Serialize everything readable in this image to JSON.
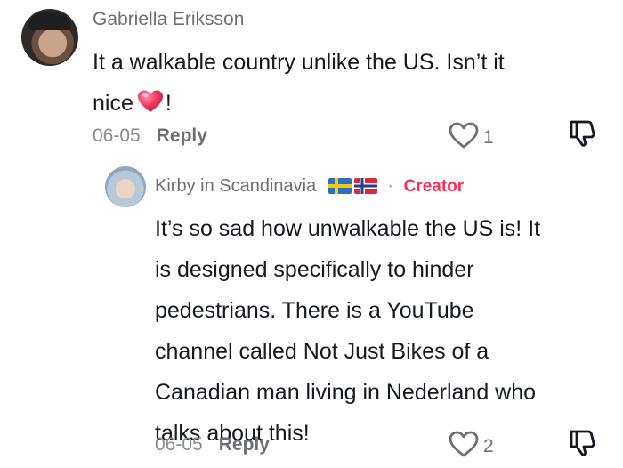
{
  "comments": [
    {
      "author": "Gabriella Eriksson",
      "text_lines": [
        "It a walkable country unlike the US. Isn’t it",
        "nice",
        "!"
      ],
      "date": "06-05",
      "reply_label": "Reply",
      "likes": "1"
    },
    {
      "author": "Kirby in Scandinavia",
      "creator_label": "Creator",
      "separator": "·",
      "text_lines": [
        "It’s so sad how unwalkable the US is! It",
        "is designed specifically to hinder",
        "pedestrians. There is a YouTube",
        "channel called Not Just Bikes of a",
        "Canadian man living in Nederland who",
        "talks about this!"
      ],
      "date": "06-05",
      "reply_label": "Reply",
      "likes": "2"
    }
  ],
  "icons": {
    "heart_emoji": "heart-emoji",
    "like": "heart-outline-icon",
    "dislike": "thumbs-down-icon",
    "flags": [
      "sweden-flag",
      "norway-flag"
    ]
  },
  "colors": {
    "creator": "#fe2c55",
    "text": "#161823",
    "muted": "#6e6f76"
  }
}
